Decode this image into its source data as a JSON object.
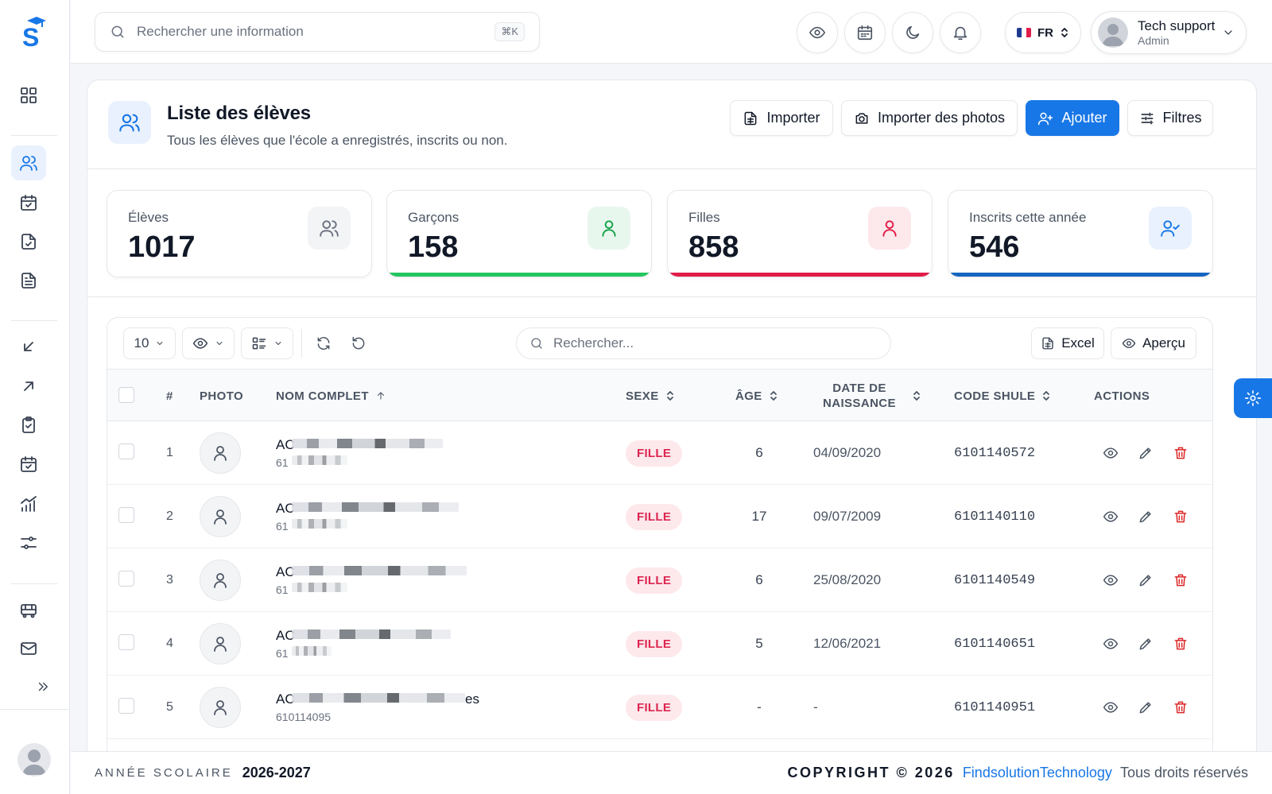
{
  "topbar": {
    "search_placeholder": "Rechercher une information",
    "search_shortcut": "⌘K",
    "lang": "FR",
    "user_name": "Tech support",
    "user_role": "Admin"
  },
  "header": {
    "title": "Liste des élèves",
    "subtitle": "Tous les élèves que l'école a enregistrés, inscrits ou non.",
    "btn_import": "Importer",
    "btn_import_photos": "Importer des photos",
    "btn_add": "Ajouter",
    "btn_filters": "Filtres"
  },
  "stats": [
    {
      "label": "Élèves",
      "value": "1017",
      "color": "#6b7280"
    },
    {
      "label": "Garçons",
      "value": "158",
      "color": "#16a34a"
    },
    {
      "label": "Filles",
      "value": "858",
      "color": "#e11d48"
    },
    {
      "label": "Inscrits cette année",
      "value": "546",
      "color": "#1877e6"
    }
  ],
  "table": {
    "page_size": "10",
    "search_placeholder": "Rechercher...",
    "btn_excel": "Excel",
    "btn_preview": "Aperçu",
    "columns": {
      "num": "#",
      "photo": "PHOTO",
      "name": "NOM COMPLET",
      "sex": "SEXE",
      "age": "ÂGE",
      "dob_1": "DATE DE",
      "dob_2": "NAISSANCE",
      "code": "CODE SHULE",
      "actions": "ACTIONS"
    },
    "rows": [
      {
        "num": "1",
        "name_prefix": "AC",
        "sub_prefix": "61",
        "sex": "FILLE",
        "age": "6",
        "dob": "04/09/2020",
        "code": "6101140572"
      },
      {
        "num": "2",
        "name_prefix": "AC",
        "sub_prefix": "61",
        "sex": "FILLE",
        "age": "17",
        "dob": "09/07/2009",
        "code": "6101140110"
      },
      {
        "num": "3",
        "name_prefix": "AC",
        "sub_prefix": "61",
        "sex": "FILLE",
        "age": "6",
        "dob": "25/08/2020",
        "code": "6101140549"
      },
      {
        "num": "4",
        "name_prefix": "AC",
        "sub_prefix": "61",
        "sex": "FILLE",
        "age": "5",
        "dob": "12/06/2021",
        "code": "6101140651"
      },
      {
        "num": "5",
        "name_prefix": "AC",
        "name_suffix": "es",
        "sub_prefix": "610114095",
        "sex": "FILLE",
        "age": "-",
        "dob": "-",
        "code": "6101140951"
      }
    ]
  },
  "footer": {
    "year_label": "ANNÉE SCOLAIRE",
    "year": "2026-2027",
    "copyright": "COPYRIGHT © 2026",
    "brand": "FindsolutionTechnology",
    "rights": "Tous droits réservés"
  },
  "colors": {
    "accent": "#1877e6",
    "girl_badge": "#dc2650"
  }
}
